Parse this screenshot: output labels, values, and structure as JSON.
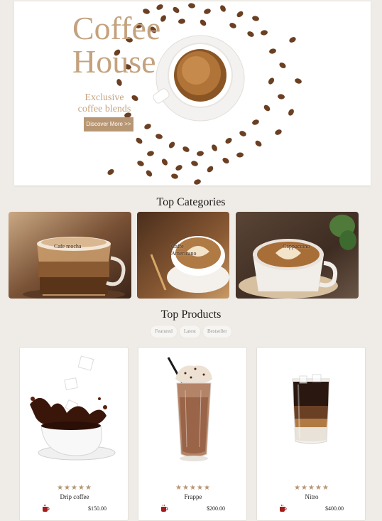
{
  "hero": {
    "title_line1": "Coffee",
    "title_line2": "House",
    "subtitle": "Exclusive coffee blends",
    "cta_label": "Discover More >>"
  },
  "categories": {
    "heading": "Top Categories",
    "items": [
      {
        "label": "Cafe mocha"
      },
      {
        "label": "Caffe Americano"
      },
      {
        "label": "Cappuccino"
      }
    ]
  },
  "products": {
    "heading": "Top Products",
    "tabs": [
      "Featured",
      "Latest",
      "Bestseller"
    ],
    "items": [
      {
        "name": "Drip coffee",
        "price": "$150.00",
        "stars": "★★★★★"
      },
      {
        "name": "Frappe",
        "price": "$200.00",
        "stars": "★★★★★"
      },
      {
        "name": "Nitro",
        "price": "$400.00",
        "stars": "★★★★★"
      }
    ]
  },
  "colors": {
    "accent": "#b79673",
    "hero_text": "#c4a27e",
    "background": "#efebe6",
    "cart_icon": "#a31d1d"
  }
}
